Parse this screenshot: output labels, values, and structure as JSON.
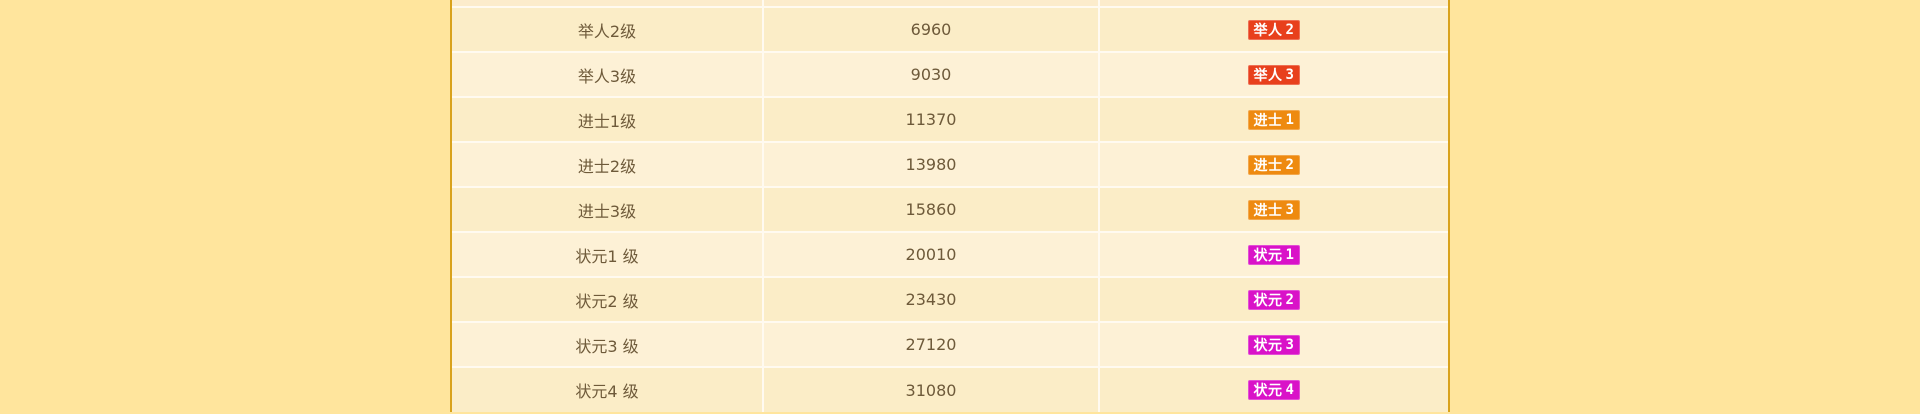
{
  "colors": {
    "page_background": "#ffe59d",
    "frame_border": "#d9a21b",
    "text": "#6e5a3a",
    "badge_juren": "#e8401c",
    "badge_jinshi": "#ee8a10",
    "badge_zhuangyuan": "#d912c8"
  },
  "rows": [
    {
      "level": "举人2级",
      "points": "6960",
      "badge": {
        "text": "举人",
        "num": "2",
        "color": "#e8401c"
      }
    },
    {
      "level": "举人3级",
      "points": "9030",
      "badge": {
        "text": "举人",
        "num": "3",
        "color": "#e8401c"
      }
    },
    {
      "level": "进士1级",
      "points": "11370",
      "badge": {
        "text": "进士",
        "num": "1",
        "color": "#ee8a10"
      }
    },
    {
      "level": "进士2级",
      "points": "13980",
      "badge": {
        "text": "进士",
        "num": "2",
        "color": "#ee8a10"
      }
    },
    {
      "level": "进士3级",
      "points": "15860",
      "badge": {
        "text": "进士",
        "num": "3",
        "color": "#ee8a10"
      }
    },
    {
      "level": "状元1 级",
      "points": "20010",
      "badge": {
        "text": "状元",
        "num": "1",
        "color": "#d912c8"
      }
    },
    {
      "level": "状元2 级",
      "points": "23430",
      "badge": {
        "text": "状元",
        "num": "2",
        "color": "#d912c8"
      }
    },
    {
      "level": "状元3 级",
      "points": "27120",
      "badge": {
        "text": "状元",
        "num": "3",
        "color": "#d912c8"
      }
    },
    {
      "level": "状元4 级",
      "points": "31080",
      "badge": {
        "text": "状元",
        "num": "4",
        "color": "#d912c8"
      }
    }
  ]
}
